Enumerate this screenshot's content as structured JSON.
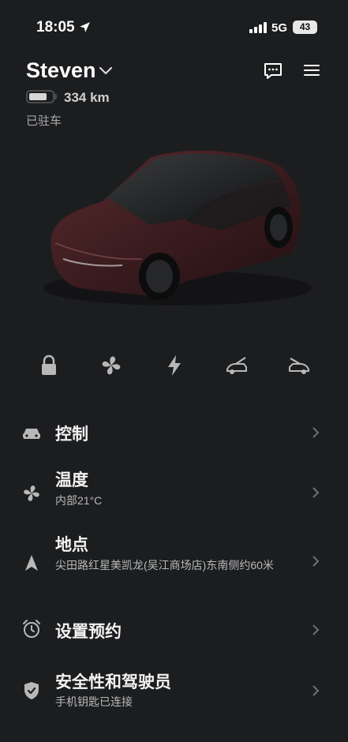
{
  "status_bar": {
    "time": "18:05",
    "network": "5G",
    "battery": "43"
  },
  "vehicle": {
    "name": "Steven",
    "range": "334 km",
    "state": "已驻车",
    "battery_level": 0.8
  },
  "quick_controls": [
    "lock-icon",
    "fan-icon",
    "charge-icon",
    "frunk-icon",
    "trunk-icon"
  ],
  "menu": [
    {
      "title": "控制",
      "subtitle": "",
      "icon": "car-icon"
    },
    {
      "title": "温度",
      "subtitle": "内部21°C",
      "icon": "fan-icon"
    },
    {
      "title": "地点",
      "subtitle": "尖田路红星美凯龙(吴江商场店)东南侧约60米",
      "icon": "navigation-icon"
    },
    {
      "title": "设置预约",
      "subtitle": "",
      "icon": "alarm-clock-icon"
    },
    {
      "title": "安全性和驾驶员",
      "subtitle": "手机钥匙已连接",
      "icon": "shield-check-icon"
    }
  ],
  "colors": {
    "background": "#1c1d1f",
    "text": "#ffffff",
    "muted": "#a9a9a9",
    "icon": "#b8b8b8"
  }
}
